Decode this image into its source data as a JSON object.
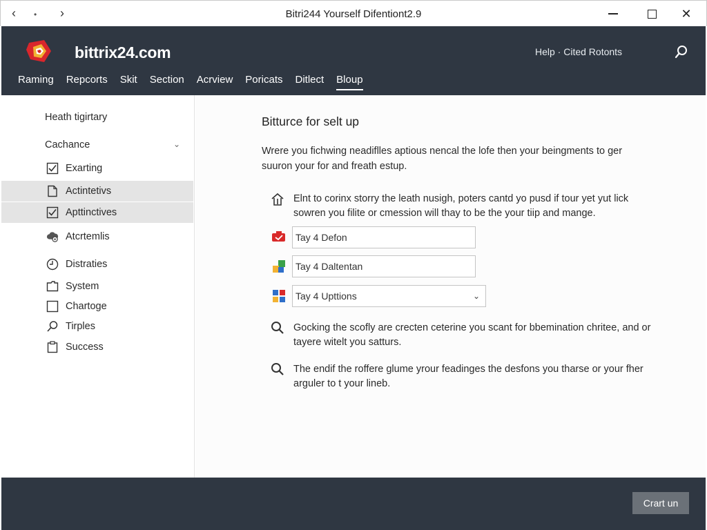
{
  "window": {
    "title": "Bitri244 Yourself Difentiont2.9",
    "back_glyph": "‹",
    "dot_glyph": "•",
    "forward_glyph": "›",
    "close_glyph": "✕"
  },
  "header": {
    "brand": "bittrix24.com",
    "help_link": "Help · Cited Rotonts",
    "nav": [
      {
        "label": "Raming",
        "active": false
      },
      {
        "label": "Repcorts",
        "active": false
      },
      {
        "label": "Skit",
        "active": false
      },
      {
        "label": "Section",
        "active": false
      },
      {
        "label": "Acrview",
        "active": false
      },
      {
        "label": "Poricats",
        "active": false
      },
      {
        "label": "Ditlect",
        "active": false
      },
      {
        "label": "Bloup",
        "active": true
      }
    ]
  },
  "sidebar": {
    "heading": "Heath tigirtary",
    "group": {
      "label": "Cachance",
      "chevron": "⌄"
    },
    "items": [
      {
        "label": "Exarting",
        "icon": "checkbox-checked-icon"
      },
      {
        "label": "Actintetivs",
        "icon": "document-icon"
      },
      {
        "label": "Apttinctives",
        "icon": "checkbox-checked-icon"
      },
      {
        "label": "Atcrtemlis",
        "icon": "cloud-settings-icon"
      },
      {
        "label": "Distraties",
        "icon": "clock-icon"
      },
      {
        "label": "System",
        "icon": "folder-icon"
      },
      {
        "label": "Chartoge",
        "icon": "checkbox-empty-icon"
      },
      {
        "label": "Tirples",
        "icon": "search-icon"
      },
      {
        "label": "Success",
        "icon": "clipboard-icon"
      }
    ]
  },
  "main": {
    "title": "Bitturce for selt up",
    "intro": "Wrere you fichwing neadiflles aptious nencal the lofe then your beingments to ger suuron your for and freath estup.",
    "para1": "Elnt to corinx storry the leath nusigh, poters cantd yo pusd if tour yet yut lick sowren you filite or cmession will thay to be the your tiip and mange.",
    "fields": [
      {
        "value": "Tay 4 Defon",
        "icon": "red-tag-icon"
      },
      {
        "value": "Tay 4 Daltentan",
        "icon": "green-blocks-icon"
      },
      {
        "value": "Tay 4 Upttions",
        "icon": "colored-grid-icon",
        "chevron": "⌄"
      }
    ],
    "para2": "Gocking the scofly are crecten ceterine you scant for bbemination chritee, and or tayere witelt you satturs.",
    "para3": "The endif the roffere glume yrour feadinges the desfons you tharse or your fher arguler to t your lineb."
  },
  "footer": {
    "start_button": "Crart un"
  }
}
